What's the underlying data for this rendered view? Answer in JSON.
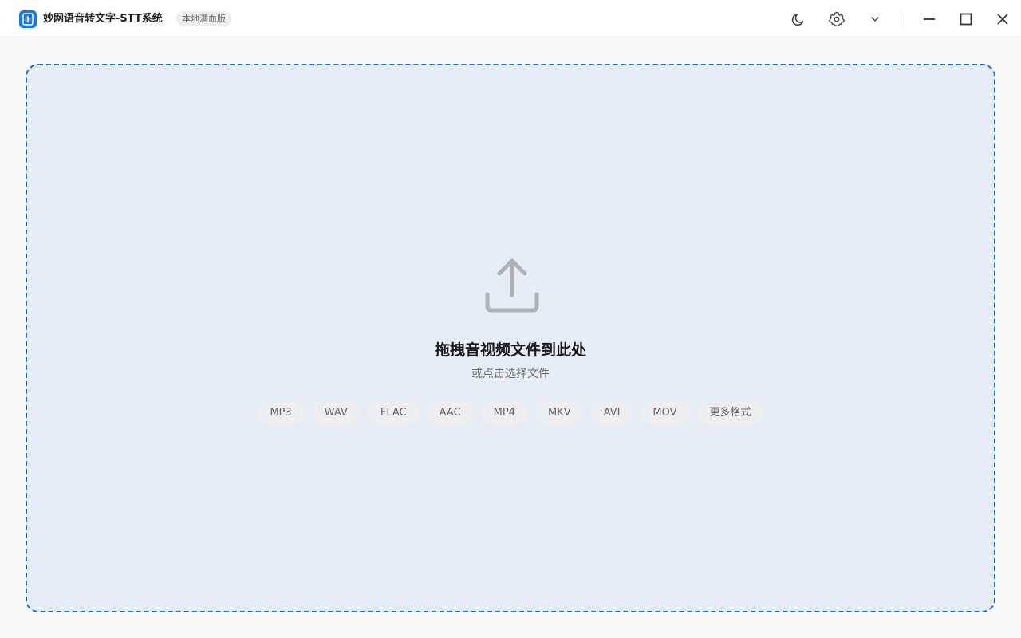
{
  "app": {
    "title": "妙网语音转文字-STT系统",
    "edition_badge": "本地满血版",
    "logo_icon": "audio-doc-icon"
  },
  "titlebar": {
    "icons": [
      "moon-icon",
      "gear-icon",
      "chevron-down-icon",
      "minimize-icon",
      "maximize-icon",
      "close-icon"
    ]
  },
  "dropzone": {
    "icon": "upload-icon",
    "title": "拖拽音视频文件到此处",
    "subtitle": "或点击选择文件",
    "formats": [
      "MP3",
      "WAV",
      "FLAC",
      "AAC",
      "MP4",
      "MKV",
      "AVI",
      "MOV",
      "更多格式"
    ]
  },
  "colors": {
    "accent": "#1677e8",
    "dropzone_border": "#1a6fd0",
    "dropzone_bg": "#e6edf6",
    "page_bg": "#f6f8fa"
  }
}
